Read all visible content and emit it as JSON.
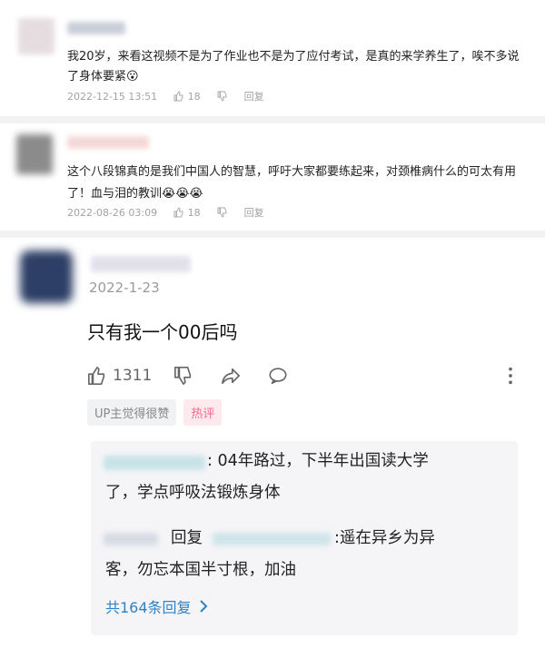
{
  "comments": [
    {
      "text": "我20岁，来看这视频不是为了作业也不是为了应付考试，是真的来学养生了，唉不多说了身体要紧",
      "emoji": "😮",
      "date": "2022-12-15 13:51",
      "likes": "18",
      "reply_label": "回复"
    },
    {
      "text": "这个八段锦真的是我们中国人的智慧，呼吁大家都要练起来，对颈椎病什么的可太有用了！血与泪的教训",
      "emoji": "😭😭😭",
      "date": "2022-08-26 03:09",
      "likes": "18",
      "reply_label": "回复"
    }
  ],
  "main_comment": {
    "date": "2022-1-23",
    "text": "只有我一个00后吗",
    "likes": "1311",
    "tags": [
      "UP主觉得很赞",
      "热评"
    ],
    "replies": [
      {
        "line1": ": 04年路过，下半年出国读大学",
        "line2": "了，学点呼吸法锻炼身体"
      },
      {
        "reply_word": "回复",
        "line1": ":遥在异乡为异",
        "line2": "客，勿忘本国半寸根，加油"
      }
    ],
    "more_replies": "共164条回复"
  },
  "colors": {
    "accent_blue": "#2f82c6",
    "hot_pink": "#f06a8b"
  }
}
